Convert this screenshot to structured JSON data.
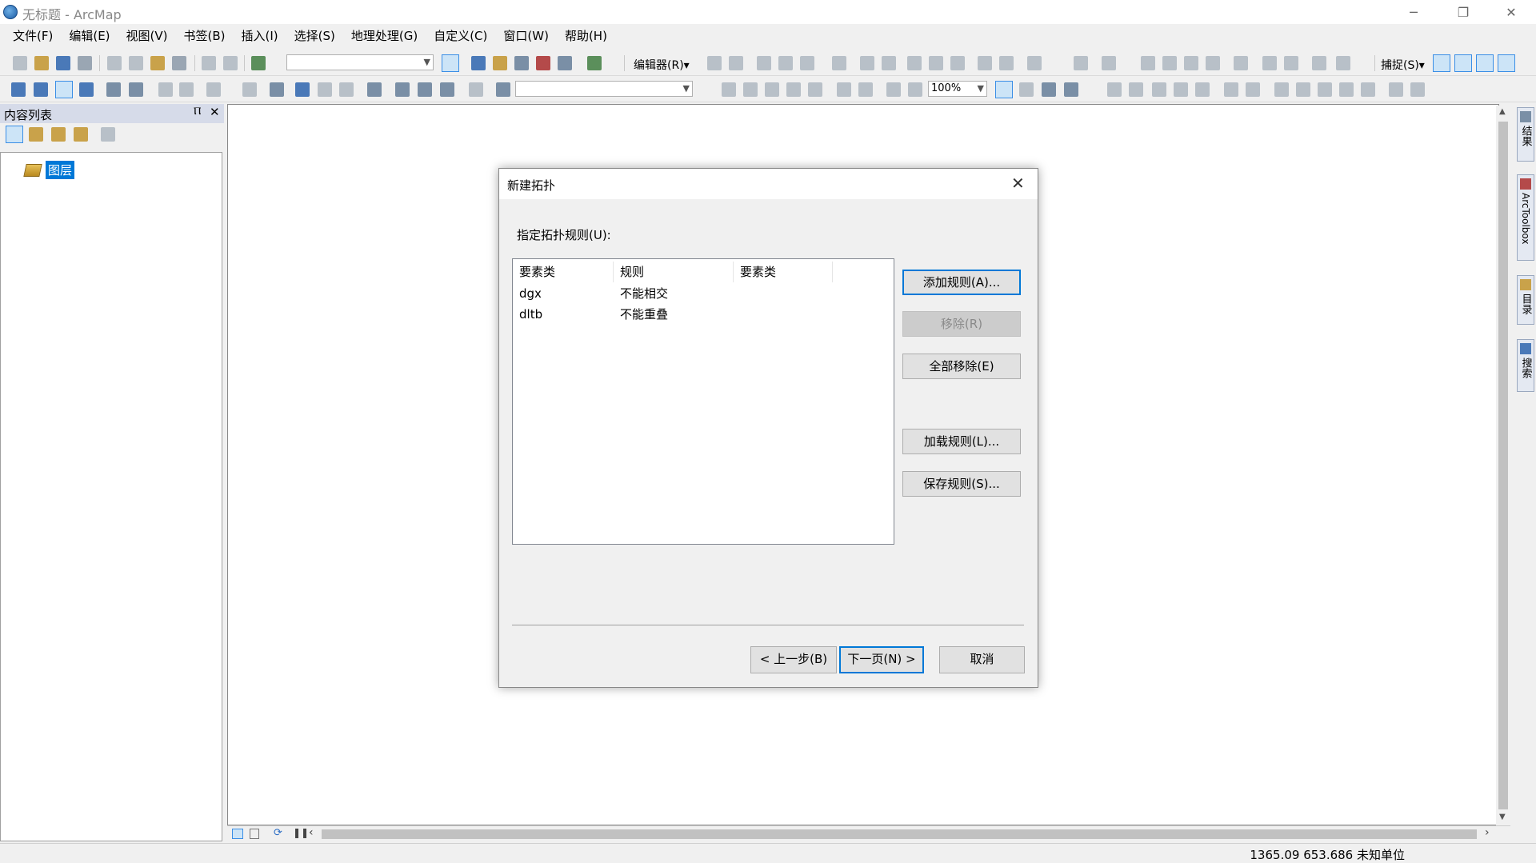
{
  "window": {
    "title": "无标题 - ArcMap",
    "controls": {
      "minimize": "─",
      "restore": "❐",
      "close": "✕"
    }
  },
  "menu": [
    "文件(F)",
    "编辑(E)",
    "视图(V)",
    "书签(B)",
    "插入(I)",
    "选择(S)",
    "地理处理(G)",
    "自定义(C)",
    "窗口(W)",
    "帮助(H)"
  ],
  "toolbar": {
    "editor_label": "编辑器(R)▾",
    "snapping_label": "捕捉(S)▾",
    "zoom_value": "100%"
  },
  "toc": {
    "title": "内容列表",
    "pin": "Ⲡ",
    "close": "✕",
    "root_label": "图层"
  },
  "side_tabs": [
    "结果",
    "ArcToolbox",
    "目录",
    "搜索"
  ],
  "status": {
    "coords": "1365.09  653.686 未知单位"
  },
  "dialog": {
    "title": "新建拓扑",
    "close": "✕",
    "rules_label": "指定拓扑规则(U):",
    "columns": [
      "要素类",
      "规则",
      "要素类"
    ],
    "rows": [
      {
        "feature_class": "dgx",
        "rule": "不能相交",
        "feature_class2": ""
      },
      {
        "feature_class": "dltb",
        "rule": "不能重叠",
        "feature_class2": ""
      }
    ],
    "buttons": {
      "add_rule": "添加规则(A)...",
      "remove": "移除(R)",
      "remove_all": "全部移除(E)",
      "load_rules": "加载规则(L)...",
      "save_rules": "保存规则(S)...",
      "back": "< 上一步(B)",
      "next": "下一页(N) >",
      "cancel": "取消"
    }
  },
  "colors": {
    "accent": "#0078d7",
    "panel_header": "#d6dbe9"
  }
}
